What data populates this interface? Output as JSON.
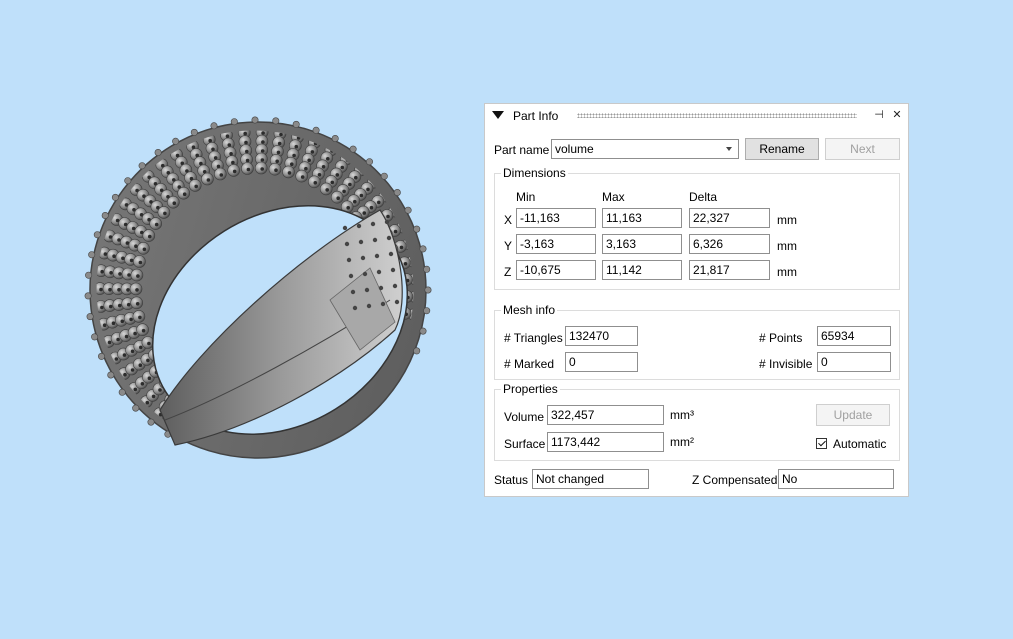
{
  "panel": {
    "title": "Part Info",
    "part_name_label": "Part name",
    "part_name_value": "volume",
    "rename_label": "Rename",
    "next_label": "Next"
  },
  "dimensions": {
    "title": "Dimensions",
    "headers": [
      "Min",
      "Max",
      "Delta"
    ],
    "unit": "mm",
    "rows": [
      {
        "axis": "X",
        "min": "-11,163",
        "max": "11,163",
        "delta": "22,327"
      },
      {
        "axis": "Y",
        "min": "-3,163",
        "max": "3,163",
        "delta": "6,326"
      },
      {
        "axis": "Z",
        "min": "-10,675",
        "max": "11,142",
        "delta": "21,817"
      }
    ]
  },
  "mesh_info": {
    "title": "Mesh info",
    "triangles_label": "# Triangles",
    "triangles_value": "132470",
    "points_label": "# Points",
    "points_value": "65934",
    "marked_label": "# Marked",
    "marked_value": "0",
    "invisible_label": "# Invisible",
    "invisible_value": "0"
  },
  "properties": {
    "title": "Properties",
    "volume_label": "Volume",
    "volume_value": "322,457",
    "volume_unit": "mm³",
    "surface_label": "Surface",
    "surface_value": "1173,442",
    "surface_unit": "mm²",
    "update_label": "Update",
    "automatic_label": "Automatic",
    "automatic_checked": true
  },
  "status": {
    "status_label": "Status",
    "status_value": "Not changed",
    "z_comp_label": "Z Compensated",
    "z_comp_value": "No"
  },
  "colors": {
    "background": "#bfe0fa",
    "ring": "#6f6f6f"
  }
}
